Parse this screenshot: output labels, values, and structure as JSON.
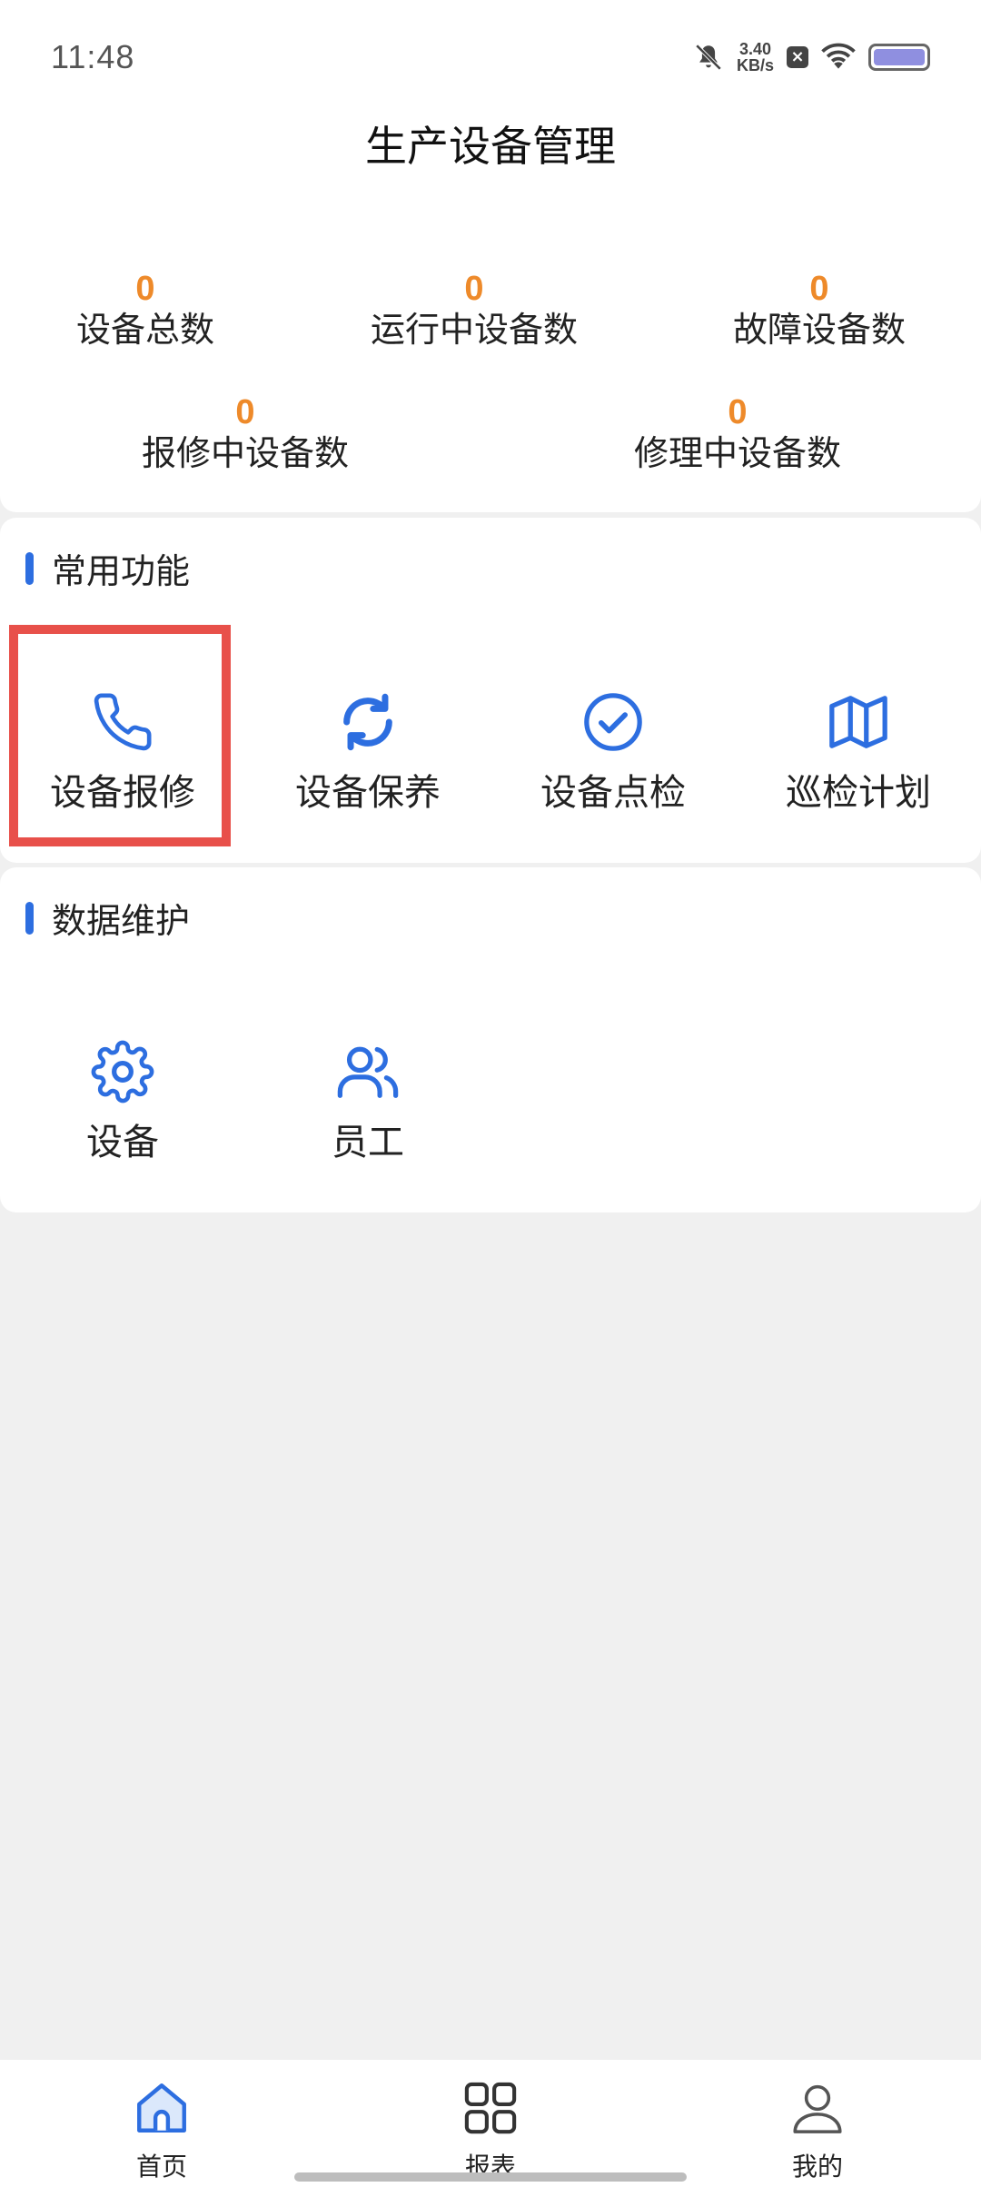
{
  "status_bar": {
    "time": "11:48",
    "net_speed_value": "3.40",
    "net_speed_unit": "KB/s"
  },
  "header": {
    "title": "生产设备管理"
  },
  "stats": [
    {
      "value": "0",
      "label": "设备总数"
    },
    {
      "value": "0",
      "label": "运行中设备数"
    },
    {
      "value": "0",
      "label": "故障设备数"
    },
    {
      "value": "0",
      "label": "报修中设备数"
    },
    {
      "value": "0",
      "label": "修理中设备数"
    }
  ],
  "common_functions": {
    "title": "常用功能",
    "items": [
      {
        "label": "设备报修",
        "icon": "phone-icon"
      },
      {
        "label": "设备保养",
        "icon": "refresh-icon"
      },
      {
        "label": "设备点检",
        "icon": "check-circle-icon"
      },
      {
        "label": "巡检计划",
        "icon": "map-icon"
      }
    ]
  },
  "data_maintenance": {
    "title": "数据维护",
    "items": [
      {
        "label": "设备",
        "icon": "gear-icon"
      },
      {
        "label": "员工",
        "icon": "users-icon"
      }
    ]
  },
  "bottom_nav": {
    "items": [
      {
        "label": "首页",
        "icon": "home-icon",
        "active": true
      },
      {
        "label": "报表",
        "icon": "grid-icon",
        "active": false
      },
      {
        "label": "我的",
        "icon": "user-icon",
        "active": false
      }
    ]
  },
  "colors": {
    "accent": "#2d6ee0",
    "stat_value": "#ee8a2a",
    "highlight": "#e8504a"
  }
}
